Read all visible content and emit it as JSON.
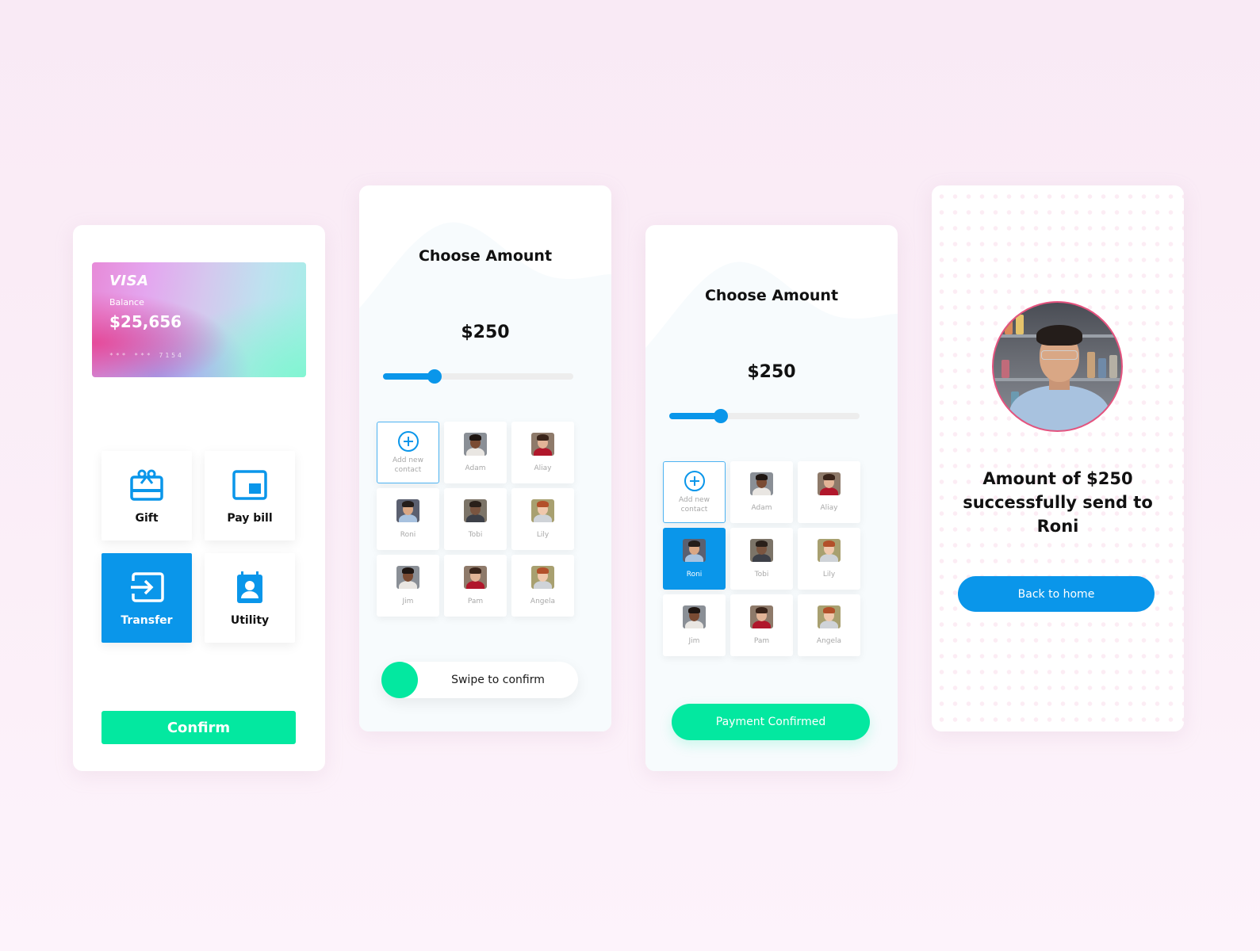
{
  "colors": {
    "primary_blue": "#0a96ea",
    "accent_green": "#03e8a0",
    "background_pink": "#f9eaf5",
    "avatar_ring": "#e5537f"
  },
  "screen1": {
    "card": {
      "brand": "VISA",
      "balance_label": "Balance",
      "balance": "$25,656",
      "number_masked": "*** *** 7154"
    },
    "tiles": [
      {
        "label": "Gift",
        "icon": "gift-card-icon",
        "active": false
      },
      {
        "label": "Pay bill",
        "icon": "bill-icon",
        "active": false
      },
      {
        "label": "Transfer",
        "icon": "transfer-icon",
        "active": true
      },
      {
        "label": "Utility",
        "icon": "contact-calendar-icon",
        "active": false
      }
    ],
    "confirm_label": "Confirm"
  },
  "screen2": {
    "title": "Choose Amount",
    "amount": "$250",
    "slider_fraction": 0.27,
    "add_contact_label": "Add new contact",
    "contacts": [
      "Adam",
      "Aliay",
      "Roni",
      "Tobi",
      "Lily",
      "Jim",
      "Pam",
      "Angela"
    ],
    "selected_contact": null,
    "swipe_label": "Swipe to confirm"
  },
  "screen3": {
    "title": "Choose Amount",
    "amount": "$250",
    "slider_fraction": 0.27,
    "add_contact_label": "Add new contact",
    "contacts": [
      "Adam",
      "Aliay",
      "Roni",
      "Tobi",
      "Lily",
      "Jim",
      "Pam",
      "Angela"
    ],
    "selected_contact": "Roni",
    "confirmed_label": "Payment Confirmed"
  },
  "screen4": {
    "recipient": "Roni",
    "message": "Amount of $250 successfully send to Roni",
    "back_home_label": "Back to home"
  }
}
